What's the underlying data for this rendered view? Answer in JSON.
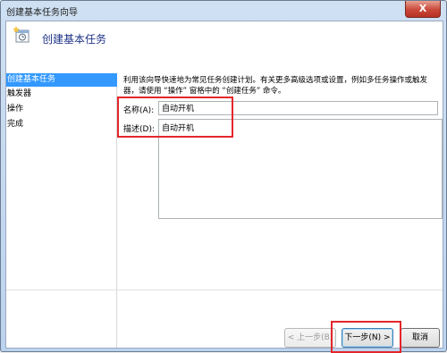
{
  "window": {
    "title": "创建基本任务向导",
    "close_glyph": "X"
  },
  "header": {
    "heading": "创建基本任务",
    "icon": "task-wizard-icon"
  },
  "sidebar": {
    "items": [
      {
        "label": "创建基本任务"
      },
      {
        "label": "触发器"
      },
      {
        "label": "操作"
      },
      {
        "label": "完成"
      }
    ],
    "active_index": 0
  },
  "main": {
    "description": "利用该向导快速地为常见任务创建计划。有关更多高级选项或设置，例如多任务操作或触发器，请使用 “操作” 窗格中的 “创建任务” 命令。",
    "name_label": "名称(A):",
    "name_value": "自动开机",
    "desc_label": "描述(D):",
    "desc_value": "自动开机"
  },
  "buttons": {
    "back_label": "< 上一步(B)",
    "next_label": "下一步(N) >",
    "cancel_label": "取消"
  },
  "colors": {
    "highlight": "#3399ff",
    "annotation_red": "#e4262b",
    "heading": "#1e3287"
  }
}
